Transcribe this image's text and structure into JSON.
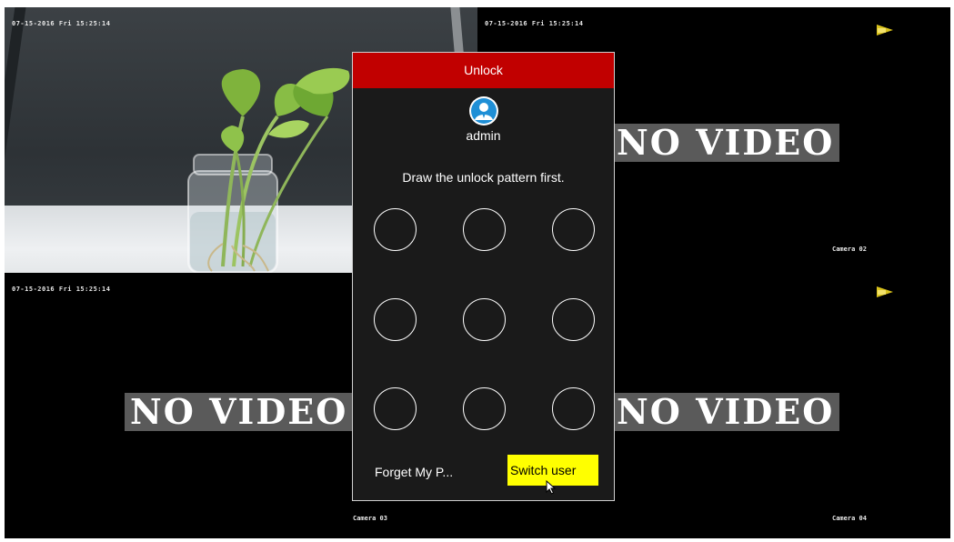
{
  "osd": {
    "timestamp_1": "07-15-2016 Fri 15:25:14",
    "timestamp_2": "07-15-2016 Fri 15:25:14",
    "timestamp_3": "07-15-2016 Fri 15:25:14",
    "camera_02": "Camera 02",
    "camera_03": "Camera 03",
    "camera_04": "Camera 04",
    "no_video": "NO VIDEO"
  },
  "dialog": {
    "title": "Unlock",
    "user": "admin",
    "instruction": "Draw the unlock pattern first.",
    "forget_label": "Forget My P...",
    "switch_label": "Switch user"
  },
  "icons": {
    "avatar": "user-avatar-icon",
    "record": "record-status-icon",
    "cursor": "mouse-pointer-icon"
  },
  "colors": {
    "header": "#c10000",
    "switch_button": "#ffff00",
    "no_video_bg": "#5a5a5a"
  }
}
